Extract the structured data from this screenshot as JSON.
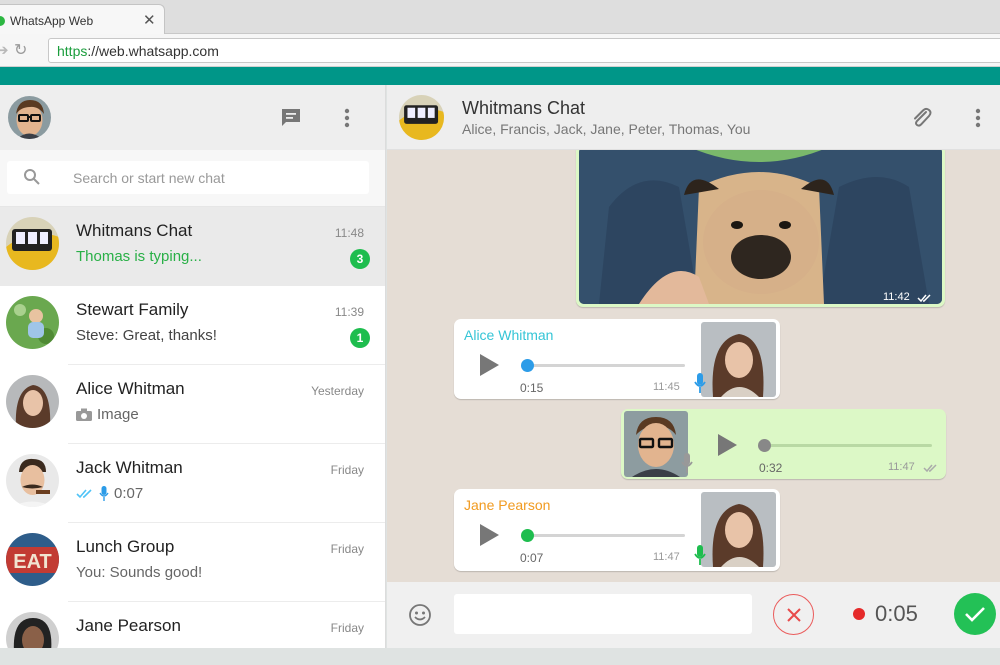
{
  "browser": {
    "tab_title": "WhatsApp Web",
    "tab_close": "✕",
    "url_scheme": "https",
    "url_rest": "://web.whatsapp.com"
  },
  "sidebar": {
    "search_placeholder": "Search or start new chat",
    "chats": [
      {
        "name": "Whitmans Chat",
        "time": "11:48",
        "preview": "Thomas is typing...",
        "badge": "3",
        "avatar": "bus-avatar"
      },
      {
        "name": "Stewart Family",
        "time": "11:39",
        "preview": "Steve: Great, thanks!",
        "badge": "1",
        "avatar": "baby-avatar"
      },
      {
        "name": "Alice Whitman",
        "time": "Yesterday",
        "preview": "Image",
        "preview_icon": "camera-icon",
        "avatar": "woman-avatar"
      },
      {
        "name": "Jack Whitman",
        "time": "Friday",
        "preview": "0:07",
        "preview_icon": "double-check-mic-icon",
        "avatar": "mustache-avatar"
      },
      {
        "name": "Lunch Group",
        "time": "Friday",
        "preview": "You: Sounds good!",
        "avatar": "eat-sign-avatar"
      },
      {
        "name": "Jane Pearson",
        "time": "Friday",
        "preview": "",
        "avatar": "jane-avatar"
      }
    ]
  },
  "conversation": {
    "title": "Whitmans Chat",
    "members": "Alice, Francis, Jack, Jane, Peter, Thomas, You",
    "messages": [
      {
        "type": "image",
        "direction": "out",
        "time": "11:42",
        "status": "read"
      },
      {
        "type": "voice",
        "direction": "in",
        "sender": "Alice Whitman",
        "sender_color": "#35c5d6",
        "duration": "0:15",
        "time": "11:45",
        "mic_color": "#2c9ce8",
        "progress": 0
      },
      {
        "type": "voice",
        "direction": "out",
        "duration": "0:32",
        "time": "11:47",
        "status": "read",
        "progress": 0
      },
      {
        "type": "voice",
        "direction": "in",
        "sender": "Jane Pearson",
        "sender_color": "#f19b21",
        "duration": "0:07",
        "time": "11:47",
        "mic_color": "#1ebd4e",
        "progress": 0
      }
    ]
  },
  "composer": {
    "recording_time": "0:05"
  },
  "colors": {
    "accent_teal": "#009688",
    "badge_green": "#1ebd4e",
    "outgoing_bubble": "#dcf8c6",
    "record_red": "#e52a2a"
  }
}
